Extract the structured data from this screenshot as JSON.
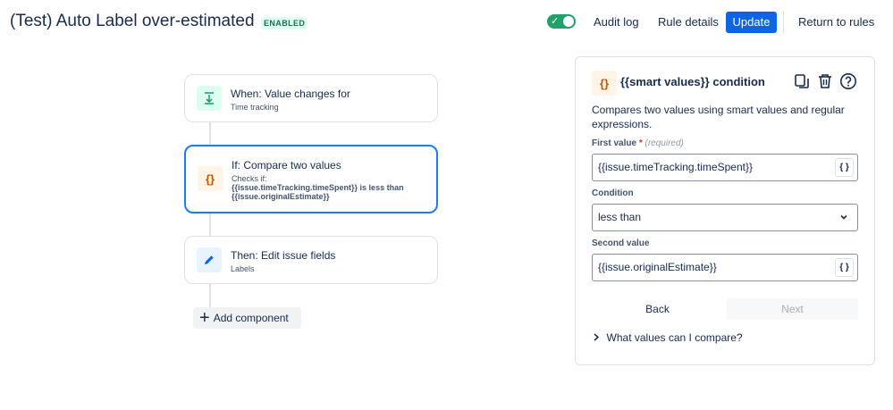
{
  "header": {
    "title": "(Test) Auto Label over-estimated",
    "status_badge": "ENABLED",
    "toggle_check": "✓",
    "audit_log": "Audit log",
    "rule_details": "Rule details",
    "update": "Update",
    "return_to_rules": "Return to rules"
  },
  "flow": {
    "trigger": {
      "title": "When: Value changes for",
      "subtitle": "Time tracking"
    },
    "condition": {
      "title": "If: Compare two values",
      "checks_label": "Checks if:",
      "checks_expr_1": "{{issue.timeTracking.timeSpent}} is less than",
      "checks_expr_2": "{{issue.originalEstimate}}",
      "icon_text": "{}"
    },
    "action": {
      "title": "Then: Edit issue fields",
      "subtitle": "Labels"
    },
    "add_component": "Add component"
  },
  "panel": {
    "icon_text": "{}",
    "title": "{{smart values}} condition",
    "description": "Compares two values using smart values and regular expressions.",
    "first_value_label": "First value",
    "required_marker": "*",
    "required_text": "(required)",
    "first_value": "{{issue.timeTracking.timeSpent}}",
    "condition_label": "Condition",
    "condition_value": "less than",
    "second_value_label": "Second value",
    "second_value": "{{issue.originalEstimate}}",
    "smart_button": "{ }",
    "back": "Back",
    "next": "Next",
    "what_values": "What values can I compare?"
  },
  "colors": {
    "accent": "#0c66e4",
    "toggle_on": "#22a06b",
    "selected_border": "#1d7afc"
  },
  "icons": [
    "toggle-check-icon",
    "trigger-icon",
    "condition-icon",
    "pencil-icon",
    "plus-icon",
    "copy-icon",
    "trash-icon",
    "help-icon",
    "chevron-down-icon",
    "chevron-right-icon"
  ]
}
